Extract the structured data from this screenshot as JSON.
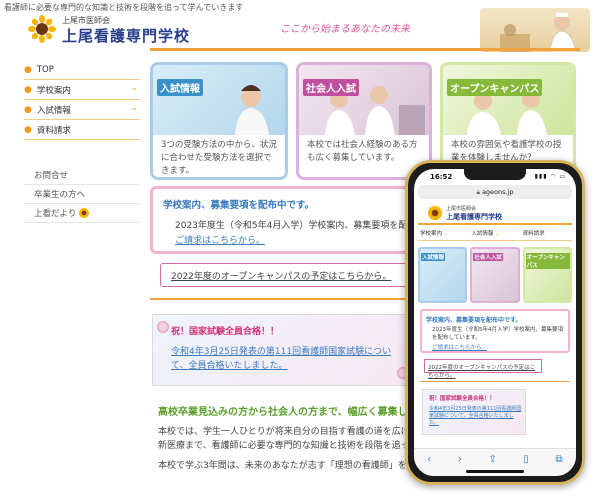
{
  "header": {
    "tagline": "看護師に必要な専門的な知識と技術を段階を追って学んでいきます",
    "org_name": "上尾市医師会",
    "school_name": "上尾看護専門学校",
    "slogan": "ここから始まるあなたの未来"
  },
  "sidebar": {
    "items": [
      {
        "label": "TOP",
        "has_submenu": false
      },
      {
        "label": "学校案内",
        "has_submenu": true
      },
      {
        "label": "入試情報",
        "has_submenu": true
      },
      {
        "label": "資料請求",
        "has_submenu": false
      }
    ],
    "links": [
      {
        "label": "お問合せ"
      },
      {
        "label": "卒業生の方へ"
      },
      {
        "label": "上看だより"
      }
    ]
  },
  "cards": [
    {
      "title": "入試情報",
      "body": "3つの受験方法の中から、状況に合わせた受験方法を選択できます。"
    },
    {
      "title": "社会人入試",
      "body": "本校では社会人経験のある方も広く募集しています。"
    },
    {
      "title": "オープンキャンパス",
      "body": "本校の雰囲気や看護学校の授業を体験しませんか？"
    }
  ],
  "notice": {
    "title": "学校案内、募集要項を配布中です。",
    "body": "2023年度生（令和5年4月入学）学校案内、募集要項を配布しています。",
    "link": "ご請求はこちらから。"
  },
  "open_campus_link": "2022年度のオープンキャンパスの予定はこちらから。",
  "exam_banner": {
    "title": "祝！国家試験全員合格！！",
    "body": "令和4年3月25日発表の第111回看護師国家試験について、全員合格いたしました。"
  },
  "recruit": {
    "heading": "高校卒業見込みの方から社会人の方まで、幅広く募集しています。",
    "para1_line1": "本校では、学生一人ひとりが将来自分の目指す看護の道を広げられるよう、",
    "para1_line2": "新医療まで、看護師に必要な専門的な知識と技術を段階を追って学んでいきます。",
    "para2": "本校で学ぶ3年間は、未来のあなたが志す「理想の看護師」を目指す期間です。"
  },
  "phone": {
    "time": "16:52",
    "status_icons": "▮▮▮ ◠ ▭",
    "url": "ageons.jp",
    "mobile_org": "上尾市医師会",
    "mobile_school": "上尾看護専門学校",
    "nav": [
      "学校案内",
      "入試情報",
      "資料請求"
    ],
    "cards": [
      "入試情報",
      "社会人入試",
      "オープンキャンパス"
    ],
    "notice_title": "学校案内、募集要項を配布中です。",
    "notice_body": "2023年度生（令和5年4月入学）学校案内、募集要項を配布しています。",
    "notice_link": "ご請求はこちらから。",
    "open_campus_link": "2022年度のオープンキャンパスの予定はこちらから。",
    "exam_title": "祝！国家試験全員合格！！",
    "exam_body": "令和4年3月25日発表の第111回看護師国家試験について、全員合格いたしました。"
  }
}
